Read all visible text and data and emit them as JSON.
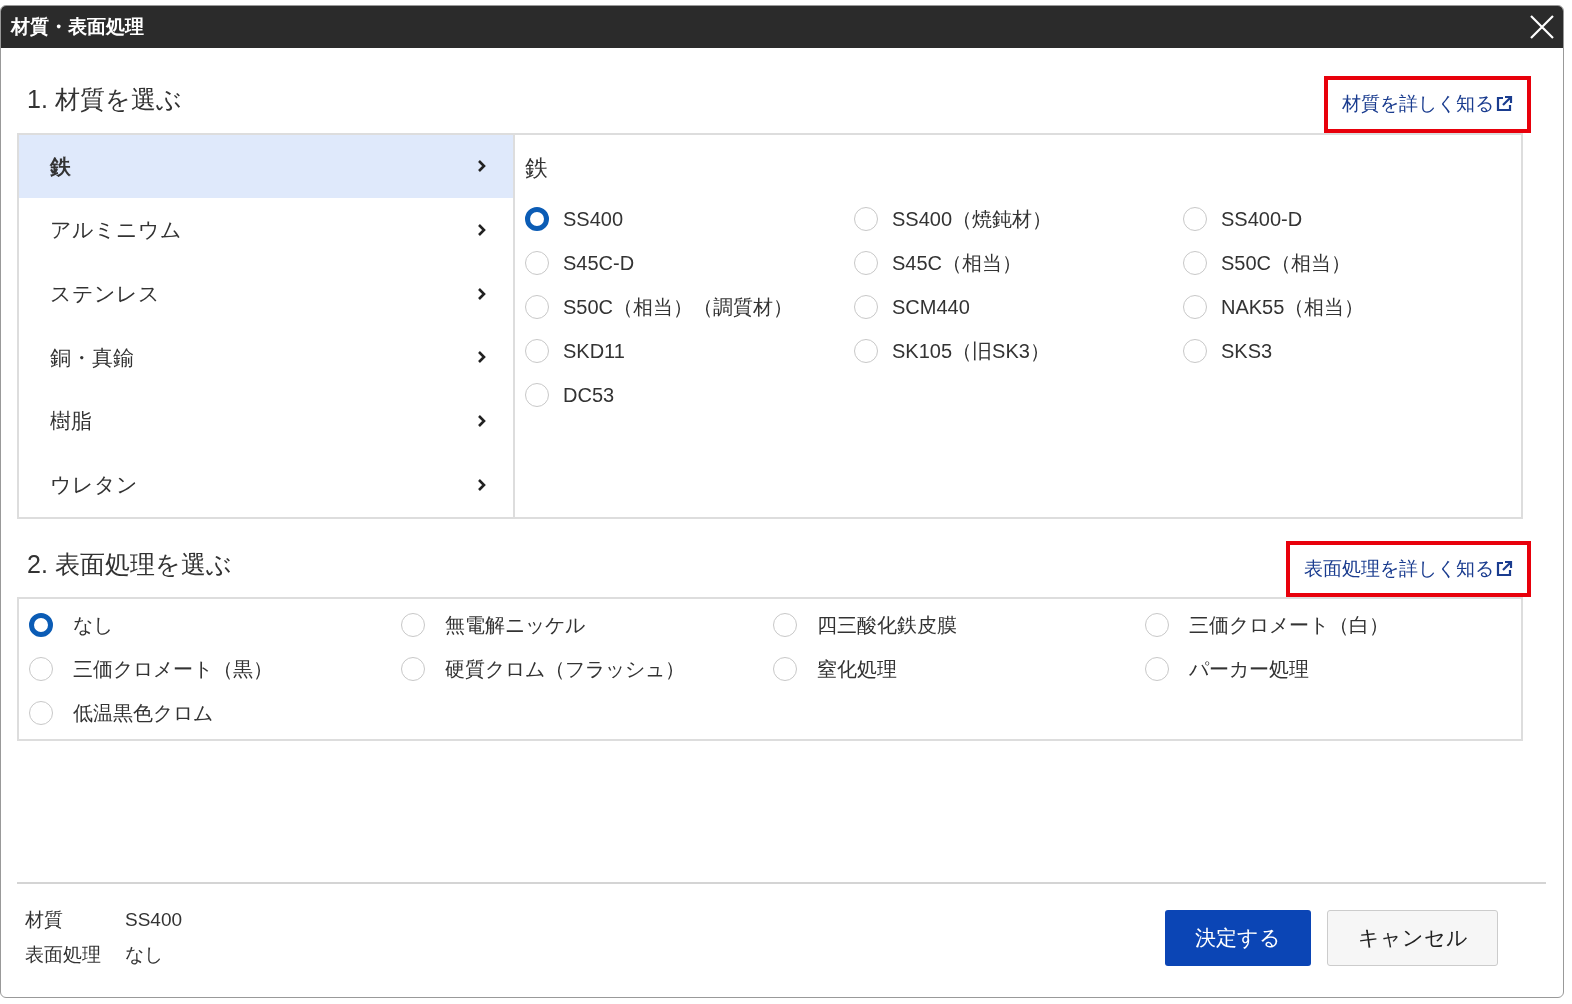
{
  "window": {
    "title": "材質・表面処理"
  },
  "material": {
    "heading": "1. 材質を選ぶ",
    "link": {
      "label": "材質を詳しく知る",
      "highlighted": true
    },
    "categories": [
      {
        "label": "鉄",
        "selected": true
      },
      {
        "label": "アルミニウム",
        "selected": false
      },
      {
        "label": "ステンレス",
        "selected": false
      },
      {
        "label": "銅・真鍮",
        "selected": false
      },
      {
        "label": "樹脂",
        "selected": false
      },
      {
        "label": "ウレタン",
        "selected": false
      }
    ],
    "group_title": "鉄",
    "options": [
      {
        "label": "SS400",
        "selected": true
      },
      {
        "label": "SS400（焼鈍材）",
        "selected": false
      },
      {
        "label": "SS400-D",
        "selected": false
      },
      {
        "label": "S45C-D",
        "selected": false
      },
      {
        "label": "S45C（相当）",
        "selected": false
      },
      {
        "label": "S50C（相当）",
        "selected": false
      },
      {
        "label": "S50C（相当）（調質材）",
        "selected": false
      },
      {
        "label": "SCM440",
        "selected": false
      },
      {
        "label": "NAK55（相当）",
        "selected": false
      },
      {
        "label": "SKD11",
        "selected": false
      },
      {
        "label": "SK105（旧SK3）",
        "selected": false
      },
      {
        "label": "SKS3",
        "selected": false
      },
      {
        "label": "DC53",
        "selected": false
      }
    ]
  },
  "surface": {
    "heading": "2. 表面処理を選ぶ",
    "link": {
      "label": "表面処理を詳しく知る",
      "highlighted": true
    },
    "options": [
      {
        "label": "なし",
        "selected": true
      },
      {
        "label": "無電解ニッケル",
        "selected": false
      },
      {
        "label": "四三酸化鉄皮膜",
        "selected": false
      },
      {
        "label": "三価クロメート（白）",
        "selected": false
      },
      {
        "label": "三価クロメート（黒）",
        "selected": false
      },
      {
        "label": "硬質クロム（フラッシュ）",
        "selected": false
      },
      {
        "label": "窒化処理",
        "selected": false
      },
      {
        "label": "パーカー処理",
        "selected": false
      },
      {
        "label": "低温黒色クロム",
        "selected": false
      }
    ]
  },
  "summary": [
    {
      "label": "材質",
      "value": "SS400"
    },
    {
      "label": "表面処理",
      "value": "なし"
    }
  ],
  "buttons": [
    {
      "label": "決定する",
      "kind": "primary"
    },
    {
      "label": "キャンセル",
      "kind": "secondary"
    }
  ]
}
